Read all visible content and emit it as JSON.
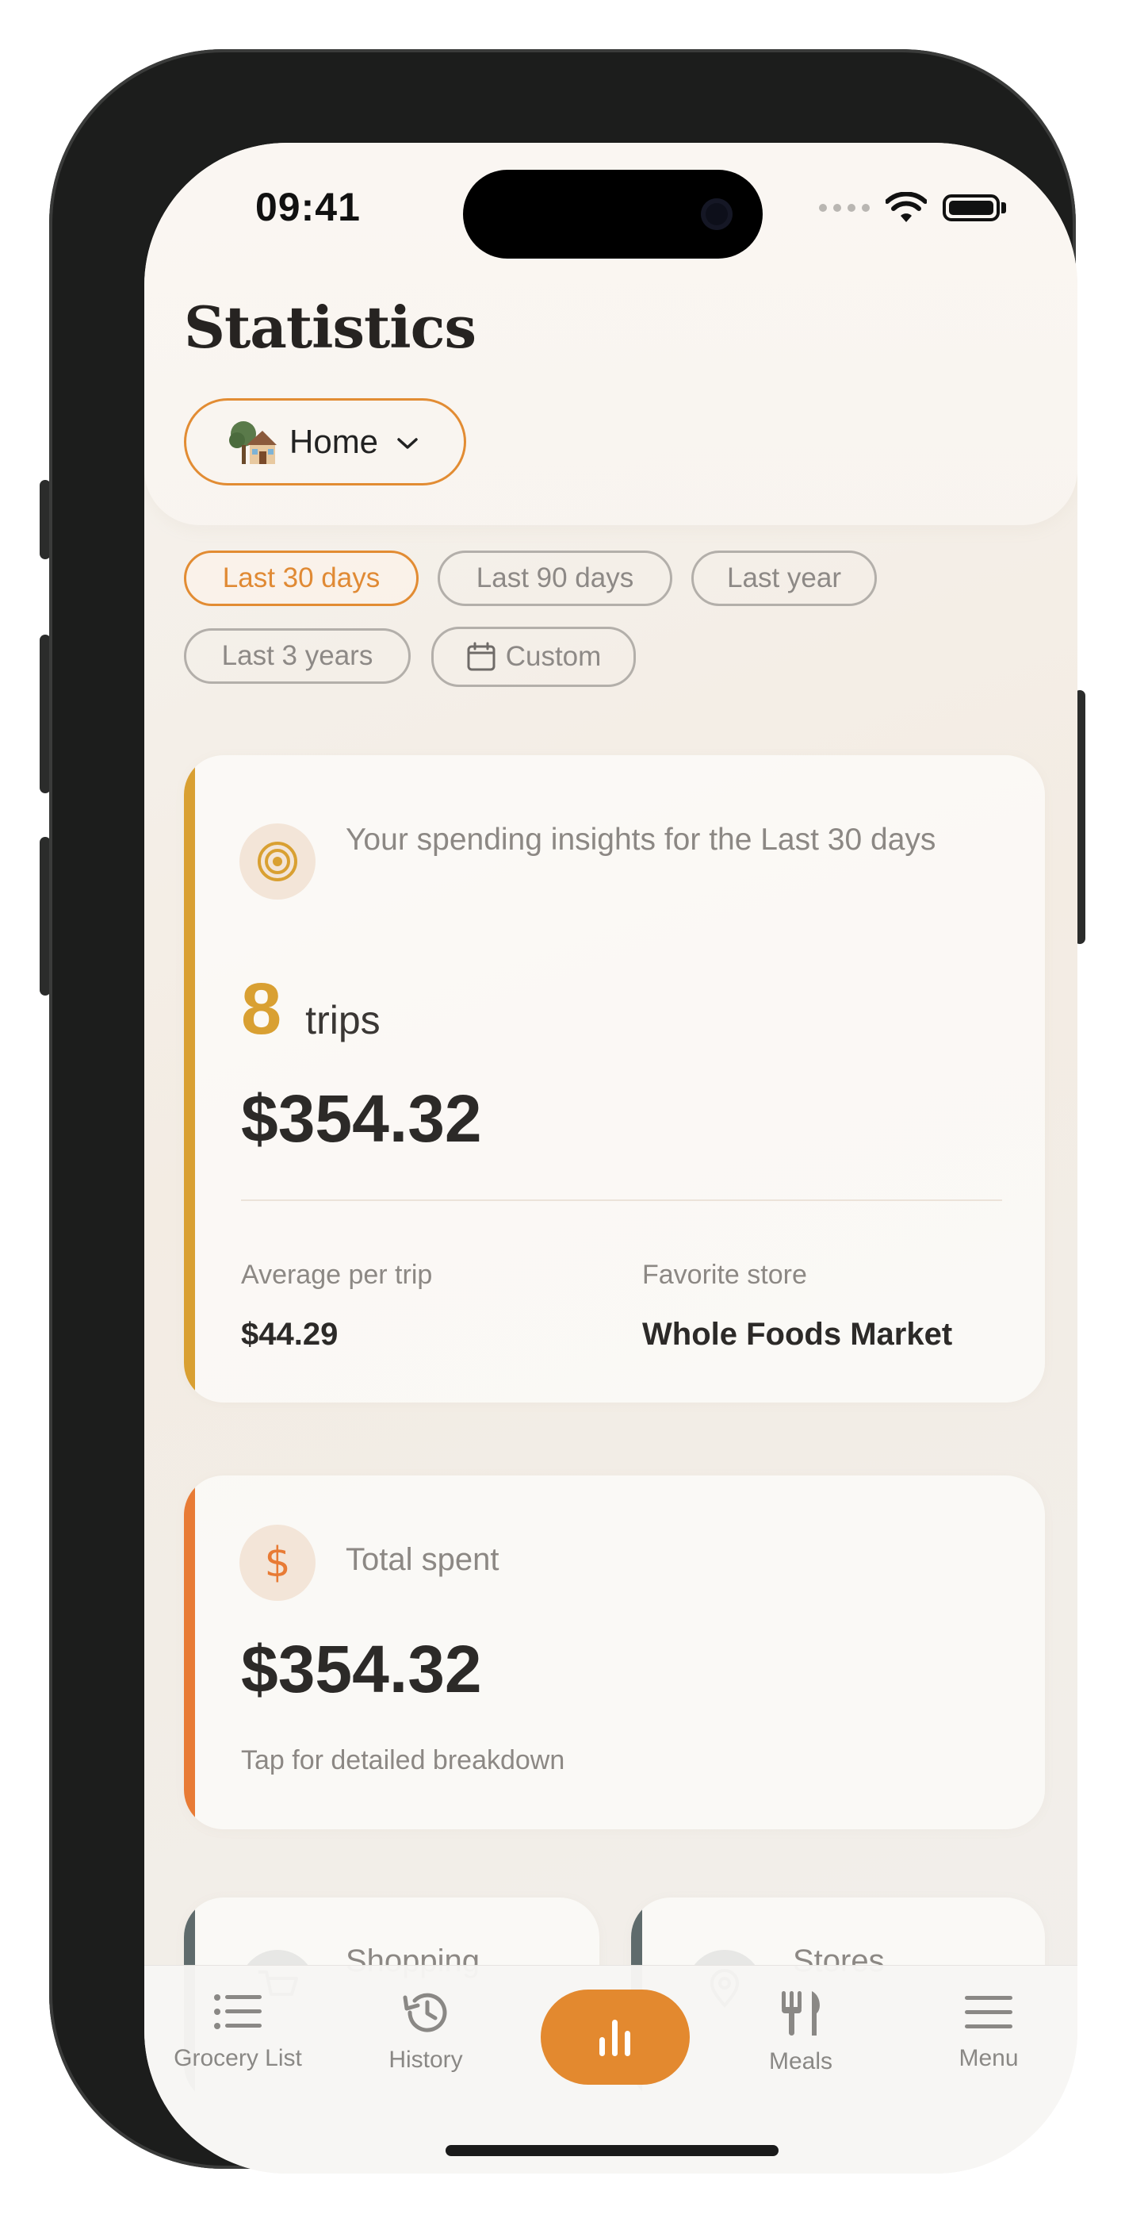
{
  "status": {
    "time": "09:41"
  },
  "header": {
    "title": "Statistics",
    "location": "Home"
  },
  "filters": {
    "ranges": [
      "Last 30 days",
      "Last 90 days",
      "Last year",
      "Last 3 years"
    ],
    "custom": "Custom",
    "selected": "Last 30 days"
  },
  "insights": {
    "subtitle": "Your spending insights for the Last 30 days",
    "trips_count": "8",
    "trips_label": "trips",
    "total": "$354.32",
    "avg_label": "Average per trip",
    "avg_value": "$44.29",
    "fav_label": "Favorite store",
    "fav_value": "Whole Foods Market"
  },
  "total_spent": {
    "label": "Total spent",
    "value": "$354.32",
    "hint": "Tap for detailed breakdown"
  },
  "mini_cards": [
    {
      "label": "Shopping"
    },
    {
      "label": "Stores"
    }
  ],
  "tabs": [
    {
      "label": "Grocery List",
      "icon": "list-icon"
    },
    {
      "label": "History",
      "icon": "history-icon"
    },
    {
      "label": "",
      "icon": "bar-chart-icon"
    },
    {
      "label": "Meals",
      "icon": "fork-knife-icon"
    },
    {
      "label": "Menu",
      "icon": "hamburger-icon"
    }
  ],
  "colors": {
    "accent_orange": "#e3892f",
    "accent_gold": "#d9a032",
    "accent_deep_orange": "#e87b35",
    "accent_slate": "#5f6b6c"
  }
}
